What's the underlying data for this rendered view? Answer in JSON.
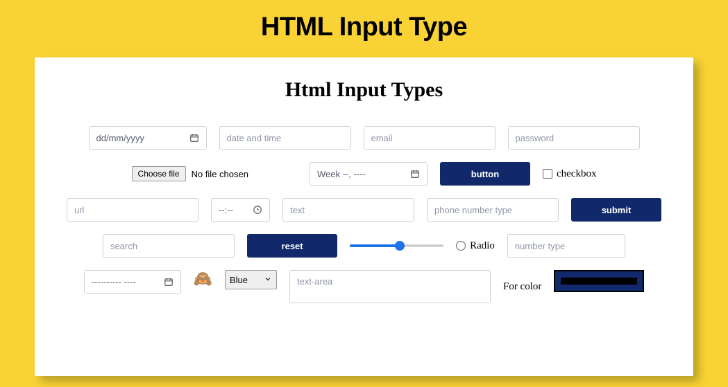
{
  "page_title": "HTML Input Type",
  "card_title": "Html Input Types",
  "row1": {
    "date_placeholder": "dd/mm/yyyy",
    "datetime_placeholder": "date and time",
    "email_placeholder": "email",
    "password_placeholder": "password"
  },
  "row2": {
    "choose_file_label": "Choose file",
    "no_file_label": "No file chosen",
    "week_value": "Week --, ----",
    "button_label": "button",
    "checkbox_label": "checkbox"
  },
  "row3": {
    "url_placeholder": "url",
    "time_value": "--:--",
    "text_placeholder": "text",
    "tel_placeholder": "phone number type",
    "submit_label": "submit"
  },
  "row4": {
    "search_placeholder": "search",
    "reset_label": "reset",
    "radio_label": "Radio",
    "number_placeholder": "number type"
  },
  "row5": {
    "month_value": "---------- ----",
    "image_emoji": "🙈",
    "select_value": "Blue",
    "textarea_placeholder": "text-area",
    "color_label": "For color"
  }
}
